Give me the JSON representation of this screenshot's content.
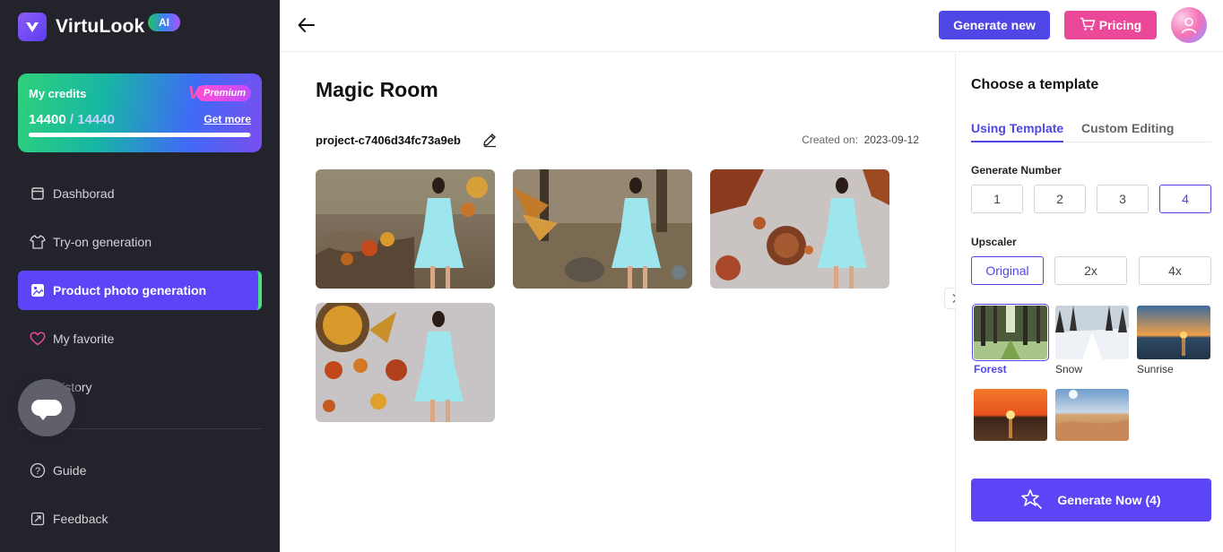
{
  "app": {
    "name": "VirtuLook",
    "badge": "AI"
  },
  "credits": {
    "title": "My credits",
    "premium_label": "Premium",
    "used": "14400",
    "separator": " / ",
    "total": "14440",
    "progress_fraction": 0.997,
    "get_more": "Get more"
  },
  "sidebar": {
    "items": [
      {
        "label": "Dashborad",
        "icon": "dashboard-icon"
      },
      {
        "label": "Try-on generation",
        "icon": "shirt-icon"
      },
      {
        "label": "Product photo generation",
        "icon": "photo-icon",
        "active": true
      },
      {
        "label": "My favorite",
        "icon": "heart-icon"
      },
      {
        "label": "History",
        "icon": "history-icon"
      }
    ],
    "bottom": [
      {
        "label": "Guide",
        "icon": "help-icon"
      },
      {
        "label": "Feedback",
        "icon": "feedback-icon"
      }
    ]
  },
  "header": {
    "generate_new": "Generate new",
    "pricing": "Pricing"
  },
  "main": {
    "title": "Magic Room",
    "project": "project-c7406d34fc73a9eb",
    "created_label": "Created on:",
    "created_value": "2023-09-12"
  },
  "panel": {
    "title": "Choose a template",
    "tabs": [
      "Using Template",
      "Custom Editing"
    ],
    "generate_number_label": "Generate Number",
    "generate_numbers": [
      "1",
      "2",
      "3",
      "4"
    ],
    "generate_number_selected": "4",
    "upscaler_label": "Upscaler",
    "upscaler_options": [
      "Original",
      "2x",
      "4x"
    ],
    "upscaler_selected": "Original",
    "templates": [
      {
        "label": "Forest",
        "selected": true
      },
      {
        "label": "Snow"
      },
      {
        "label": "Sunrise"
      },
      {
        "label": ""
      },
      {
        "label": ""
      }
    ],
    "generate_now": "Generate Now (4)"
  },
  "colors": {
    "accent": "#4f46e5",
    "pricing": "#ec4899",
    "sidebar_bg": "#22232b",
    "active_nav": "#5b45f6"
  }
}
